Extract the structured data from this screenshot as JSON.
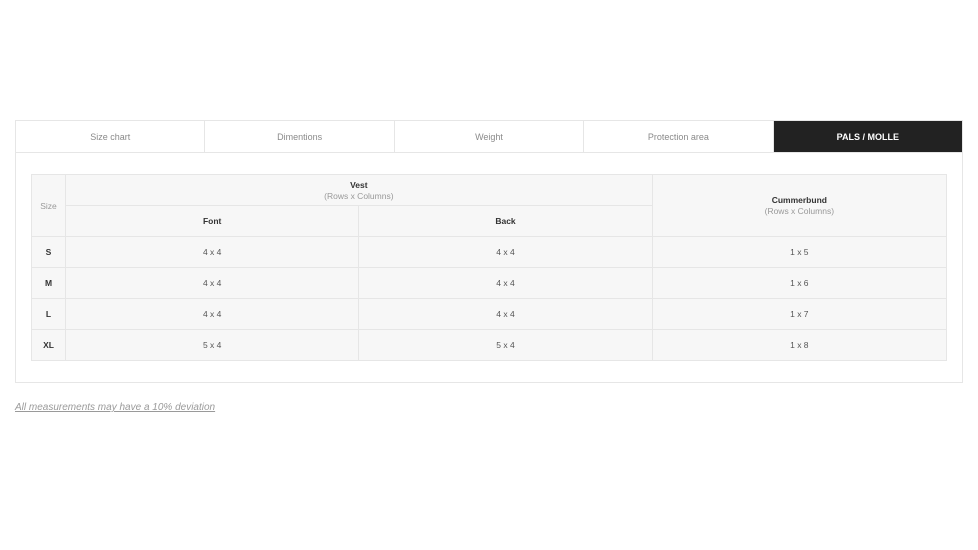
{
  "tabs": [
    {
      "label": "Size chart",
      "active": false
    },
    {
      "label": "Dimentions",
      "active": false
    },
    {
      "label": "Weight",
      "active": false
    },
    {
      "label": "Protection area",
      "active": false
    },
    {
      "label": "PALS / MOLLE",
      "active": true
    }
  ],
  "table": {
    "size_header": "Size",
    "vest": {
      "title": "Vest",
      "subtitle": "(Rows x Columns)"
    },
    "cummerbund": {
      "title": "Cummerbund",
      "subtitle": "(Rows x Columns)"
    },
    "front_header": "Font",
    "back_header": "Back",
    "rows": [
      {
        "size": "S",
        "front": "4 x 4",
        "back": "4 x 4",
        "cummerbund": "1 x 5"
      },
      {
        "size": "M",
        "front": "4 x 4",
        "back": "4 x 4",
        "cummerbund": "1 x 6"
      },
      {
        "size": "L",
        "front": "4 x 4",
        "back": "4 x 4",
        "cummerbund": "1 x 7"
      },
      {
        "size": "XL",
        "front": "5 x 4",
        "back": "5 x 4",
        "cummerbund": "1 x 8"
      }
    ]
  },
  "note": "All measurements may have a 10% deviation",
  "colors": {
    "active_tab_bg": "#222222",
    "table_bg": "#f7f7f7",
    "border": "#e6e6e6"
  }
}
